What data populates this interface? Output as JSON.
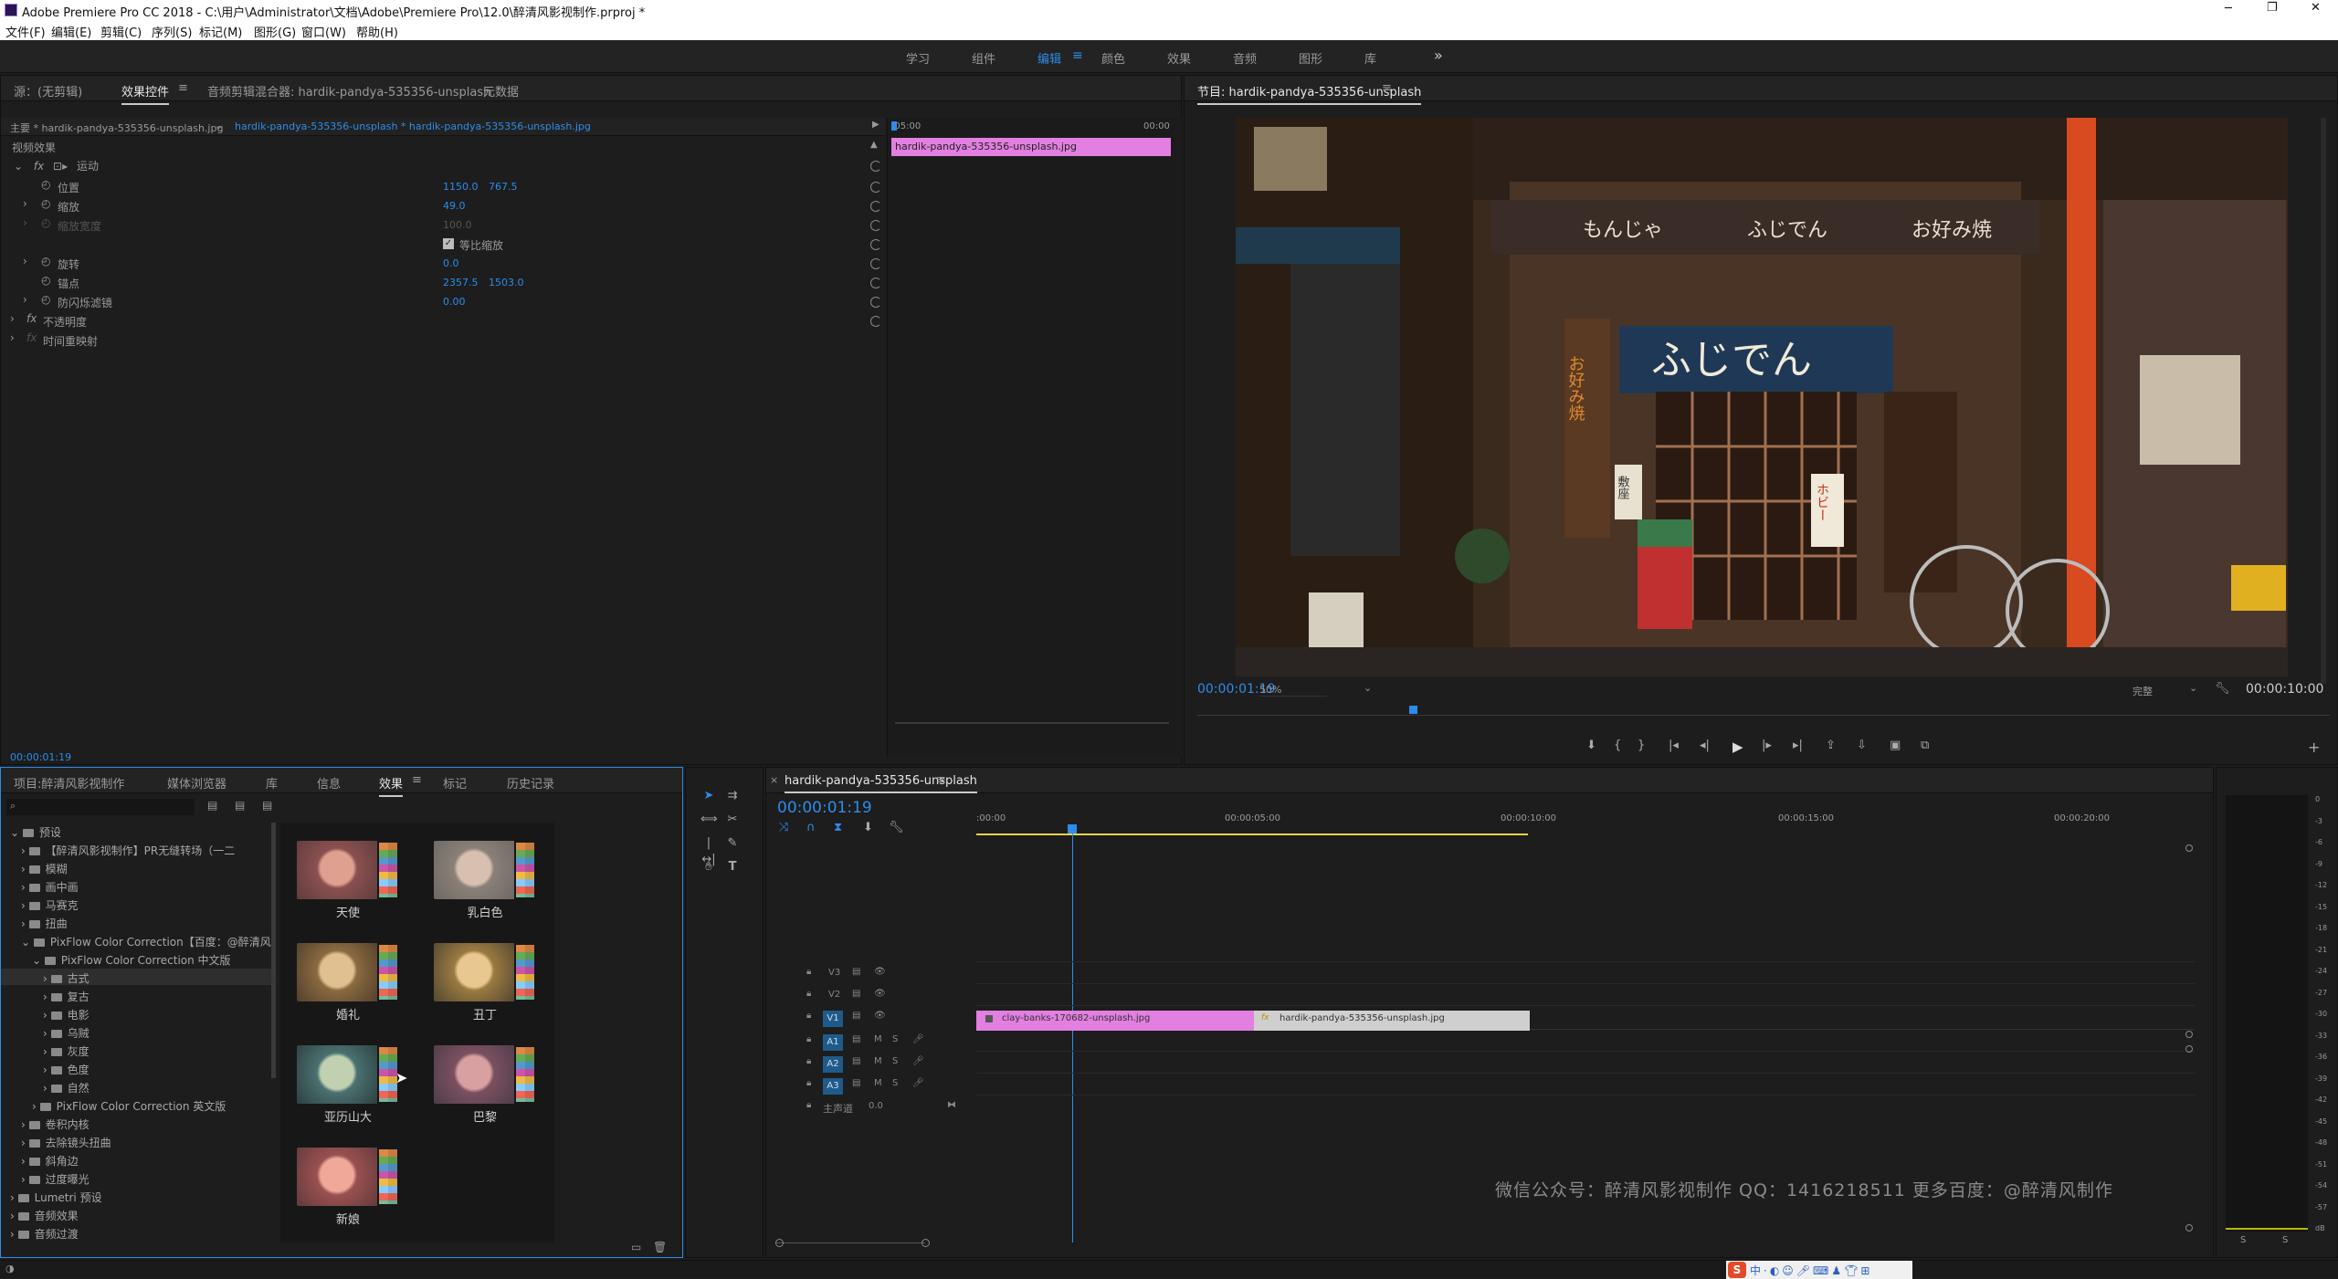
{
  "title_bar": {
    "title": "Adobe Premiere Pro CC 2018 - C:\\用户\\Administrator\\文档\\Adobe\\Premiere Pro\\12.0\\醉清风影视制作.prproj *"
  },
  "menu": [
    "文件(F)",
    "编辑(E)",
    "剪辑(C)",
    "序列(S)",
    "标记(M)",
    "图形(G)",
    "窗口(W)",
    "帮助(H)"
  ],
  "workspaces": {
    "items": [
      "学习",
      "组件",
      "编辑",
      "颜色",
      "效果",
      "音频",
      "图形",
      "库"
    ],
    "active": "编辑",
    "more": "»"
  },
  "source_panel": {
    "tabs": [
      "源：(无剪辑)",
      "效果控件",
      "音频剪辑混合器: hardik-pandya-535356-unsplash",
      "元数据"
    ],
    "master_label": "主要 * hardik-pandya-535356-unsplash.jpg",
    "clip_label": "hardik-pandya-535356-unsplash * hardik-pandya-535356-unsplash.jpg",
    "time_start": ":05:00",
    "time_end": "00:00",
    "mini_clip": "hardik-pandya-535356-unsplash.jpg",
    "section": "视频效果",
    "motion": "运动",
    "props": [
      {
        "label": "位置",
        "v1": "1150.0",
        "v2": "767.5"
      },
      {
        "label": "缩放",
        "v1": "49.0",
        "v2": ""
      },
      {
        "label": "缩放宽度",
        "v1": "100.0",
        "v2": ""
      },
      {
        "label": "等比缩放",
        "v1": "",
        "v2": ""
      },
      {
        "label": "旋转",
        "v1": "0.0",
        "v2": ""
      },
      {
        "label": "锚点",
        "v1": "2357.5",
        "v2": "1503.0"
      },
      {
        "label": "防闪烁滤镜",
        "v1": "0.00",
        "v2": ""
      }
    ],
    "opacity": "不透明度",
    "timeremap": "时间重映射",
    "timecode": "00:00:01:19"
  },
  "program": {
    "title": "节目: hardik-pandya-535356-unsplash",
    "timecode": "00:00:01:19",
    "zoom": "50%",
    "quality": "完整",
    "duration": "00:00:10:00",
    "shop": {
      "noren": "ふじでん",
      "curtain_text": [
        "もんじゃ",
        "ふじでん",
        "お好み焼"
      ],
      "side_sign": "お好み焼",
      "red_sign": "ホビー",
      "door_sign": "敷座"
    }
  },
  "project": {
    "tabs": [
      "项目:醉清风影视制作",
      "媒体浏览器",
      "库",
      "信息",
      "效果",
      "标记",
      "历史记录"
    ],
    "tree": [
      {
        "label": "预设",
        "indent": 0
      },
      {
        "label": "【醉清风影视制作】PR无缝转场（一二",
        "indent": 1
      },
      {
        "label": "模糊",
        "indent": 1
      },
      {
        "label": "画中画",
        "indent": 1
      },
      {
        "label": "马赛克",
        "indent": 1
      },
      {
        "label": "扭曲",
        "indent": 1
      },
      {
        "label": "PixFlow Color Correction【百度：@醉清风",
        "indent": 1
      },
      {
        "label": "PixFlow Color Correction 中文版",
        "indent": 2
      },
      {
        "label": "古式",
        "indent": 3
      },
      {
        "label": "复古",
        "indent": 3
      },
      {
        "label": "电影",
        "indent": 3
      },
      {
        "label": "乌贼",
        "indent": 3
      },
      {
        "label": "灰度",
        "indent": 3
      },
      {
        "label": "色度",
        "indent": 3
      },
      {
        "label": "自然",
        "indent": 3
      },
      {
        "label": "PixFlow Color Correction 英文版",
        "indent": 2
      },
      {
        "label": "卷积内核",
        "indent": 1
      },
      {
        "label": "去除镜头扭曲",
        "indent": 1
      },
      {
        "label": "斜角边",
        "indent": 1
      },
      {
        "label": "过度曝光",
        "indent": 1
      },
      {
        "label": "Lumetri 预设",
        "indent": 0
      },
      {
        "label": "音频效果",
        "indent": 0
      },
      {
        "label": "音频过渡",
        "indent": 0
      }
    ],
    "presets": [
      "天使",
      "乳白色",
      "婚礼",
      "丑丁",
      "亚历山大",
      "巴黎",
      "新娘"
    ]
  },
  "timeline": {
    "seq_name": "hardik-pandya-535356-unsplash",
    "timecode": "00:00:01:19",
    "ruler": ":00:00",
    "r1": "00:00:05:00",
    "r2": "00:00:10:00",
    "r3": "00:00:15:00",
    "r4": "00:00:20:00",
    "tracks": [
      "V3",
      "V2",
      "V1",
      "A1",
      "A2",
      "A3"
    ],
    "master": "主声道",
    "master_val": "0.0",
    "clip1": "clay-banks-170682-unsplash.jpg",
    "clip2": "hardik-pandya-535356-unsplash.jpg",
    "watermark": "微信公众号：醉清风影视制作  QQ：1416218511  更多百度：@醉清风制作"
  },
  "meter": {
    "labels": [
      "0",
      "-3",
      "-6",
      "-9",
      "-12",
      "-15",
      "-18",
      "-21",
      "-24",
      "-27",
      "-30",
      "-33",
      "-36",
      "-39",
      "-42",
      "-45",
      "-48",
      "-51",
      "-54",
      "-57",
      "dB"
    ],
    "s": "S"
  },
  "colors": {
    "accent": "#2d8ceb",
    "clip_pink": "#e27fe0",
    "clip_gray": "#cfcfcf",
    "bg": "#1d1d1d"
  }
}
